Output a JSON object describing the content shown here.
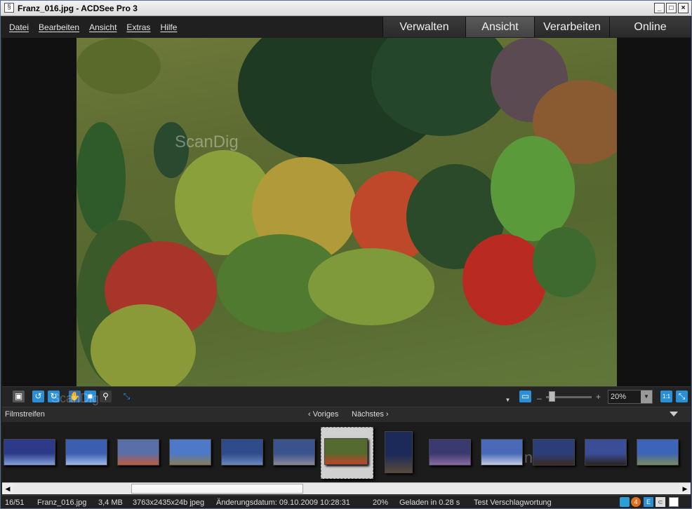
{
  "window": {
    "title": "Franz_016.jpg - ACDSee Pro 3"
  },
  "menu": [
    "Datei",
    "Bearbeiten",
    "Ansicht",
    "Extras",
    "Hilfe"
  ],
  "mode_tabs": [
    "Verwalten",
    "Ansicht",
    "Verarbeiten",
    "Online"
  ],
  "active_mode": "Ansicht",
  "viewer": {
    "watermark": "ScanDig"
  },
  "toolbar": {
    "zoom_value": "20%",
    "zoom_minus": "–",
    "zoom_plus": "+",
    "actual_size": "1:1"
  },
  "filmstrip": {
    "label": "Filmstreifen",
    "previous": "Voriges",
    "next": "Nächstes",
    "watermark": "ScanDig",
    "thumbnails": [
      {
        "color": "#2d3a8a",
        "accent": "#7fa0d8"
      },
      {
        "color": "#3b5fb0",
        "accent": "#9db8e8"
      },
      {
        "color": "#5a6fa8",
        "accent": "#c05a3a"
      },
      {
        "color": "#4d79c8",
        "accent": "#8a7a55"
      },
      {
        "color": "#2e4c8c",
        "accent": "#6b86c0"
      },
      {
        "color": "#3a528e",
        "accent": "#8a8a96"
      },
      {
        "color": "#556a2e",
        "accent": "#c0452a"
      },
      {
        "color": "#1c2a5a",
        "accent": "#5a4a3a"
      },
      {
        "color": "#3a3a70",
        "accent": "#8a6aa0"
      },
      {
        "color": "#4a6ab8",
        "accent": "#c0c8e0"
      },
      {
        "color": "#2c3e7a",
        "accent": "#3a2a24"
      },
      {
        "color": "#3a4e98",
        "accent": "#2a2220"
      },
      {
        "color": "#3c64b8",
        "accent": "#7a8a5a"
      }
    ]
  },
  "status": {
    "position": "16/51",
    "filename": "Franz_016.jpg",
    "size": "3,4 MB",
    "dimensions": "3763x2435x24b jpeg",
    "modified": "Änderungsdatum: 09.10.2009 10:28:31",
    "zoom": "20%",
    "load_time": "Geladen in 0.28 s",
    "tagline": "Test Verschlagwortung",
    "badge_number": "4",
    "badge_letter": "E"
  }
}
